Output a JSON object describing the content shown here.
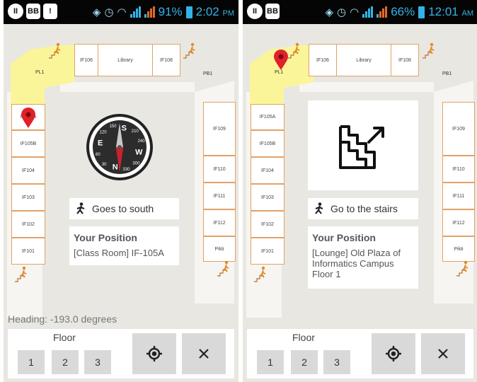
{
  "screens": [
    {
      "status": {
        "icons": [
          "II",
          "BB",
          "!"
        ],
        "battery": "91%",
        "time": "2:02",
        "ampm": "PM"
      },
      "rooms": {
        "top": [
          "IF106",
          "Library",
          "IF108"
        ],
        "left": [
          "IF105A",
          "IF105B",
          "IF104",
          "IF103",
          "IF102",
          "IF101"
        ],
        "right": [
          "IF109",
          "IF110",
          "IF111",
          "IF112",
          "Pikti"
        ],
        "labels": [
          "PL1",
          "PB1"
        ]
      },
      "direction": "Goes to south",
      "position_title": "Your Position",
      "position_text": "[Class Room] IF-105A",
      "heading": "Heading: -193.0 degrees",
      "compass": {
        "heading_deg": -193.0,
        "letters": [
          "N",
          "E",
          "S",
          "W"
        ],
        "ticks": [
          "30",
          "60",
          "120",
          "150",
          "210",
          "240",
          "300",
          "330"
        ]
      },
      "floor": {
        "title": "Floor",
        "buttons": [
          "1",
          "2",
          "3"
        ]
      },
      "icons": {
        "direction": "walking-person-icon",
        "locate": "gps-locate-icon",
        "close": "close-icon",
        "pin": "map-pin-icon"
      },
      "colors": {
        "highlight": "#fbf59a",
        "room_border": "#e0a266",
        "pin": "#e0202a"
      }
    },
    {
      "status": {
        "icons": [
          "II",
          "BB"
        ],
        "battery": "66%",
        "time": "12:01",
        "ampm": "AM"
      },
      "rooms": {
        "top": [
          "IF106",
          "Library",
          "IF108"
        ],
        "left": [
          "IF105A",
          "IF105B",
          "IF104",
          "IF103",
          "IF102",
          "IF101"
        ],
        "right": [
          "IF109",
          "IF110",
          "IF111",
          "IF112",
          "Pikti"
        ],
        "labels": [
          "PL1",
          "PB1"
        ]
      },
      "direction": "Go to the stairs",
      "position_title": "Your Position",
      "position_text": "[Lounge] Old Plaza of Informatics Campus Floor 1",
      "floor": {
        "title": "Floor",
        "buttons": [
          "1",
          "2",
          "3"
        ]
      },
      "icons": {
        "direction": "walking-person-icon",
        "locate": "gps-locate-icon",
        "close": "close-icon",
        "pin": "map-pin-icon",
        "stairs": "stairs-up-icon"
      },
      "colors": {
        "highlight": "#fbf59a",
        "room_border": "#e0a266",
        "pin": "#e0202a"
      }
    }
  ]
}
